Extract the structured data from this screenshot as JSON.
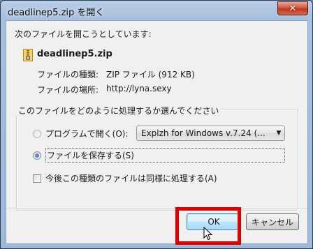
{
  "window": {
    "title": "deadlinep5.zip を開く",
    "close_label": "✕"
  },
  "dialog": {
    "intro": "次のファイルを開こうとしています:",
    "filename": "deadlinep5.zip",
    "type_label": "ファイルの種類:",
    "type_value": "ZIP ファイル (912 KB)",
    "source_label": "ファイルの場所:",
    "source_value": "http://lyna.sexy",
    "group_title": "このファイルをどのように処理するか選んでください",
    "open_with_label": "プログラムで開く(O):",
    "open_with_selected": "Explzh for Windows v.7.24 (...",
    "save_label": "ファイルを保存する(S)",
    "remember_label": "今後この種類のファイルは同様に処理する(A)"
  },
  "buttons": {
    "ok": "OK",
    "cancel": "キャンセル"
  },
  "state": {
    "selected_option": "save",
    "remember_checked": false
  },
  "colors": {
    "highlight": "#e00000",
    "titlebar": "#a7c0df",
    "close": "#c0361d"
  },
  "icons": [
    "close-icon",
    "zip-file-icon",
    "dropdown-arrow-icon",
    "mouse-cursor-icon"
  ]
}
